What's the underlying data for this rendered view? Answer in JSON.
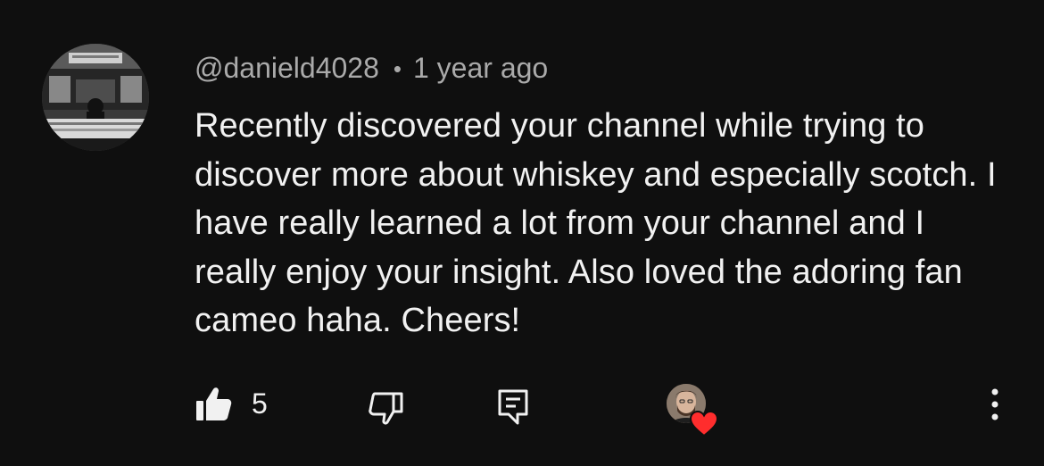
{
  "comment": {
    "author": "@danield4028",
    "separator": "•",
    "timestamp": "1 year ago",
    "text": "Recently discovered your channel while trying to discover more about whiskey and especially scotch. I have really learned a lot from your channel and I really enjoy your insight. Also loved the adoring fan cameo haha. Cheers!",
    "like_count": "5"
  },
  "icons": {
    "like": "thumb-up-filled-icon",
    "dislike": "thumb-down-outline-icon",
    "reply": "comment-reply-icon",
    "creator_heart": "creator-heart-badge",
    "more": "vertical-dots-icon"
  },
  "colors": {
    "background": "#0f0f0f",
    "primary_text": "#f1f1f1",
    "secondary_text": "#aaaaaa",
    "heart": "#ff2d2d"
  }
}
